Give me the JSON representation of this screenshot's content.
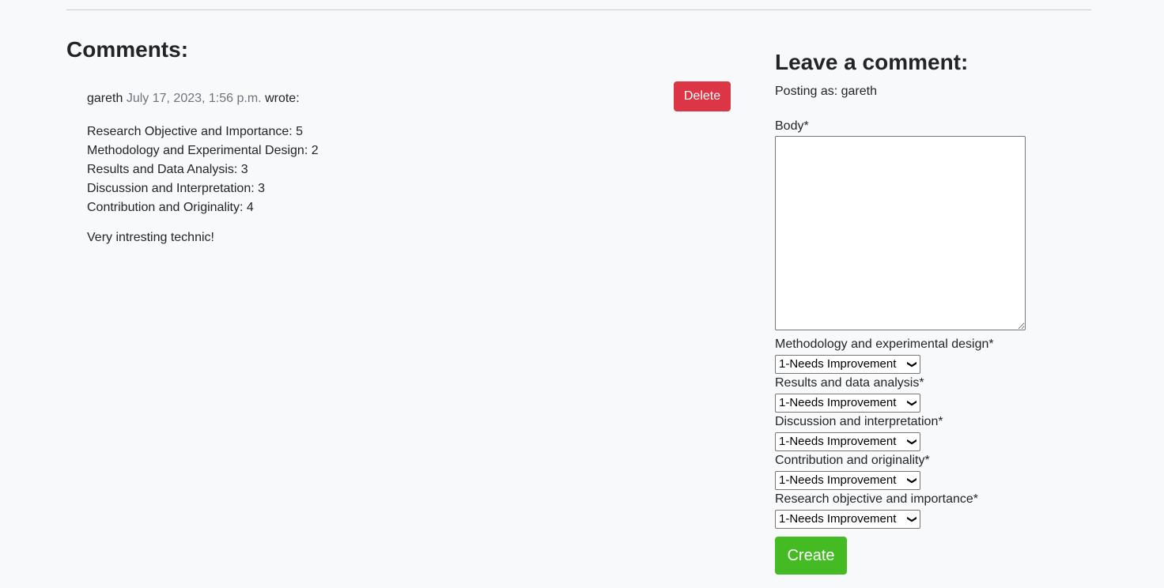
{
  "comments_section": {
    "title": "Comments:",
    "comment": {
      "author": "gareth",
      "date": "July 17, 2023, 1:56 p.m.",
      "wrote": "wrote:",
      "delete_label": "Delete",
      "scores": [
        "Research Objective and Importance: 5",
        "Methodology and Experimental Design: 2",
        "Results and Data Analysis: 3",
        "Discussion and Interpretation: 3",
        "Contribution and Originality: 4"
      ],
      "body": "Very intresting technic!"
    }
  },
  "comment_form": {
    "title": "Leave a comment:",
    "posting_as": "Posting as: gareth",
    "body_label": "Body*",
    "body_value": "",
    "fields": [
      {
        "label": "Methodology and experimental design*",
        "selected": "1-Needs Improvement"
      },
      {
        "label": "Results and data analysis*",
        "selected": "1-Needs Improvement"
      },
      {
        "label": "Discussion and interpretation*",
        "selected": "1-Needs Improvement"
      },
      {
        "label": "Contribution and originality*",
        "selected": "1-Needs Improvement"
      },
      {
        "label": "Research objective and importance*",
        "selected": "1-Needs Improvement"
      }
    ],
    "submit_label": "Create"
  },
  "colors": {
    "background": "#f8f9fa",
    "delete_button": "#dc3545",
    "create_button": "#44bb22",
    "muted_text": "#6c757d"
  }
}
